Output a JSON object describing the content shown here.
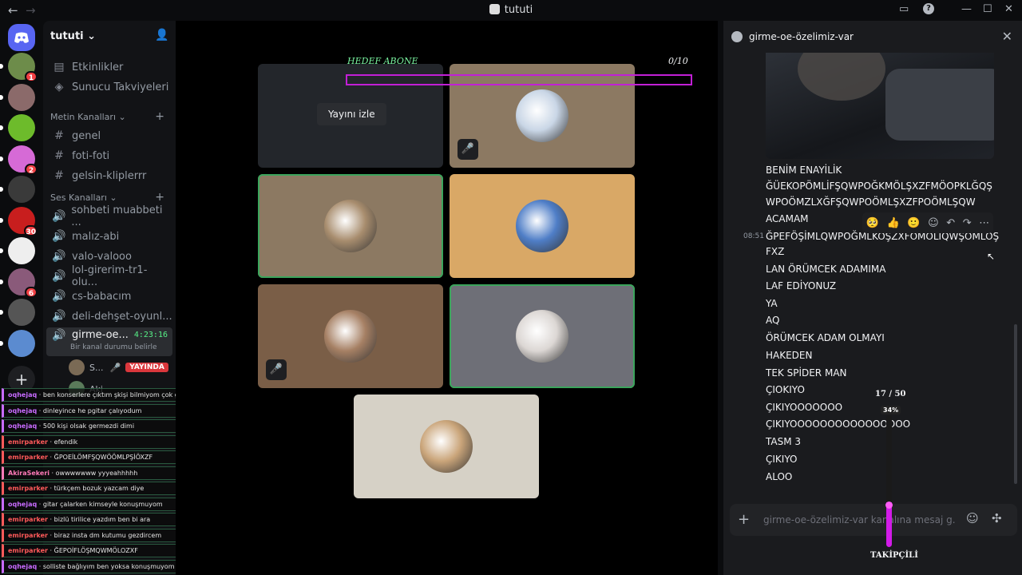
{
  "window": {
    "title": "tututi",
    "back": "←",
    "forward": "→",
    "inbox": "▭",
    "help": "?",
    "minimize": "—",
    "maximize": "☐",
    "close": "✕"
  },
  "servers": [
    {
      "color": "#6d8c4a",
      "badge": "1",
      "pill": true
    },
    {
      "color": "#8b6a6a",
      "badge": "",
      "pill": true
    },
    {
      "color": "#6dbb2b",
      "badge": "",
      "pill": true
    },
    {
      "color": "#d66ad6",
      "badge": "2",
      "pill": true
    },
    {
      "color": "#3a3a3a",
      "badge": "",
      "pill": true
    },
    {
      "color": "#c81e1e",
      "badge": "30",
      "pill": true
    },
    {
      "color": "#eeeeee",
      "badge": "",
      "pill": true
    },
    {
      "color": "#8a5a7a",
      "badge": "6",
      "pill": true
    },
    {
      "color": "#555555",
      "badge": "",
      "pill": true
    },
    {
      "color": "#5b8bd0",
      "badge": "",
      "pill": true
    }
  ],
  "add_server_icon": "+",
  "guild": {
    "name": "tututi",
    "add_member_icon": "👤",
    "events": "Etkinlikler",
    "boosts": "Sunucu Takviyeleri",
    "text_category": "Metin Kanalları",
    "text_channels": [
      "genel",
      "foti-foti",
      "gelsin-kliplerrr"
    ],
    "voice_category": "Ses Kanalları",
    "voice_channels": [
      "sohbeti muabbeti ...",
      "malız-abi",
      "valo-valooo",
      "lol-girerim-tr1-olu...",
      "cs-babacım",
      "deli-dehşet-oyunl..."
    ],
    "active_voice": {
      "name": "girme-oe...",
      "timer": "4:23:16",
      "status": "Bir kanal durumu belirle"
    },
    "voice_users": [
      {
        "name": "S...",
        "live": "YAYINDA",
        "color": "#7a6a55"
      },
      {
        "name": "Aki",
        "live": "",
        "color": "#5a7a5a"
      }
    ]
  },
  "overlay_chat": [
    {
      "user": "oqhejaq",
      "color": "#c86bff",
      "text": "ben konserlere çıktım şkişi bilmiyom çok gerdi"
    },
    {
      "user": "oqhejaq",
      "color": "#c86bff",
      "text": "dinleyince he pgitar çalıyodum"
    },
    {
      "user": "oqhejaq",
      "color": "#c86bff",
      "text": "500 kişi olsak germezdi dimi"
    },
    {
      "user": "emirparker",
      "color": "#ff5a5a",
      "text": "efendik"
    },
    {
      "user": "emirparker",
      "color": "#ff5a5a",
      "text": "ĞPOEİLÖMFŞQWÖÖMLPŞİÖXZF"
    },
    {
      "user": "AkiraSekeri",
      "color": "#ff7ab8",
      "text": "owwwwwww yyyeahhhhh"
    },
    {
      "user": "emirparker",
      "color": "#ff5a5a",
      "text": "türkçem bozuk yazcam diye"
    },
    {
      "user": "oqhejaq",
      "color": "#c86bff",
      "text": "gitar çalarken kimseyle konuşmuyom"
    },
    {
      "user": "emirparker",
      "color": "#ff5a5a",
      "text": "bizlü tirilice yazdım ben bi ara"
    },
    {
      "user": "emirparker",
      "color": "#ff5a5a",
      "text": "biraz insta dm kutumu gezdircem"
    },
    {
      "user": "emirparker",
      "color": "#ff5a5a",
      "text": "ĞEPOİFLÖŞMQWMÖLOZXF"
    },
    {
      "user": "oqhejaq",
      "color": "#c86bff",
      "text": "solliste bağlıyım ben yoksa konuşmuyom bike"
    }
  ],
  "stage": {
    "goal_label": "HEDEF ABONE",
    "goal_count": "0/10",
    "goal_progress": 0,
    "watch_button": "Yayını izle",
    "mute_icon": "🎤",
    "tiles": [
      {
        "bg": "#23262b",
        "speaking": false,
        "muted": false,
        "avatar": "",
        "stream": true
      },
      {
        "bg": "#8c7962",
        "speaking": false,
        "muted": true,
        "avatar": "#c9d6e6"
      },
      {
        "bg": "#8c7962",
        "speaking": true,
        "muted": false,
        "avatar": "#a88d6e"
      },
      {
        "bg": "#d9a866",
        "speaking": false,
        "muted": false,
        "avatar": "#4f7ec7"
      },
      {
        "bg": "#7a5e47",
        "speaking": false,
        "muted": true,
        "avatar": "#a68064"
      },
      {
        "bg": "#6e6f77",
        "speaking": true,
        "muted": false,
        "avatar": "#dcd7d4"
      },
      {
        "bg": "#d6d1c6",
        "speaking": false,
        "muted": false,
        "avatar": "#caa57a"
      }
    ]
  },
  "thread": {
    "name": "girme-oe-özelimiz-var",
    "close_icon": "✕",
    "timestamp": "08:51",
    "messages": [
      "BENİM ENAYİLİK",
      "ĞÜEKOPÖMLİFŞQWPOĞKMÖLŞXZFMÖOPKLĞQŞ",
      "WPOÖMZLXĞFŞQWPOÖMLŞXZFPOÖMLŞQW",
      "ACAMAM",
      "ĞPEFÖŞİMLQWPOĞMLKOŞZXFÖMÖLİQWŞÖMLÖŞ",
      "FXZ",
      "LAN ÖRÜMCEK ADAMIMA",
      "LAF EDİYONUZ",
      "YA",
      "AQ",
      "ÖRÜMCEK ADAM OLMAYI",
      "HAKEDEN",
      "TEK SPİDER MAN",
      "ÇIOKIYO",
      "ÇIKIYOOOOOOO",
      "ÇIKIYOOOOOOOOOOOOOOOO",
      "TASM 3",
      "ÇIKIYO",
      "ALOO"
    ],
    "reactions": [
      "🥺",
      "👍",
      "🙂",
      "☺",
      "↶",
      "↷",
      "⋯"
    ],
    "composer_placeholder": "girme-oe-özelimiz-var kanalına mesaj g...",
    "composer_plus": "+",
    "emoji_icon": "☺",
    "apps_icon": "✣"
  },
  "follower_widget": {
    "count": "17 / 50",
    "percent": "34%",
    "progress": 0.34,
    "label": "TAKİPÇİLİ"
  },
  "cursor": "↖"
}
